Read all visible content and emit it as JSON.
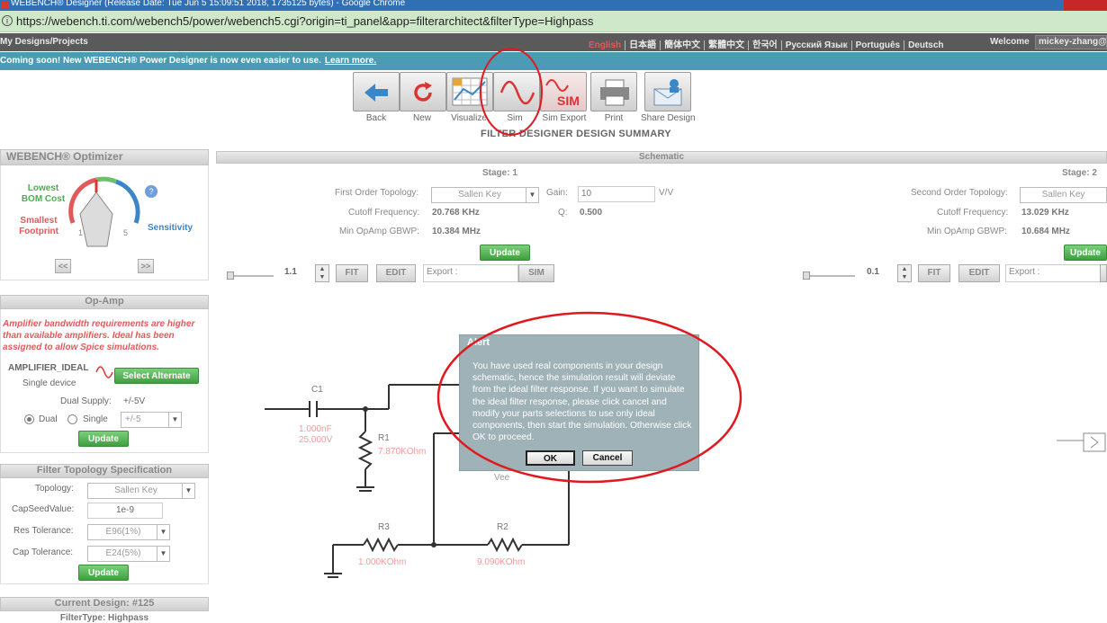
{
  "window": {
    "title": "WEBENCH® Designer (Release Date: Tue Jun 5 15:09:51 2018, 1735125 bytes) - Google Chrome"
  },
  "browser": {
    "url": "https://webench.ti.com/webench5/power/webench5.cgi?origin=ti_panel&app=filterarchitect&filterType=Highpass"
  },
  "header": {
    "left": "My Designs/Projects",
    "languages": [
      "English",
      "日本語",
      "簡体中文",
      "繁體中文",
      "한국어",
      "Русский Язык",
      "Português",
      "Deutsch"
    ],
    "welcome": "Welcome",
    "user": "mickey-zhang@"
  },
  "notice": {
    "text": "Coming soon! New WEBENCH® Power Designer is now even easier to use.",
    "link": "Learn more."
  },
  "toolbar": {
    "items": [
      {
        "label": "Back",
        "icon": "back-arrow-icon"
      },
      {
        "label": "New",
        "icon": "refresh-icon"
      },
      {
        "label": "Visualize",
        "icon": "grid-chart-icon"
      },
      {
        "label": "Sim",
        "icon": "sine-wave-icon"
      },
      {
        "label": "Sim Export",
        "icon": "sim-export-icon"
      },
      {
        "label": "Print",
        "icon": "printer-icon"
      },
      {
        "label": "Share Design",
        "icon": "share-envelope-icon"
      }
    ],
    "summary_title": "FILTER DESIGNER DESIGN SUMMARY",
    "sim_export_badge": "SIM"
  },
  "optimizer": {
    "title": "WEBENCH® Optimizer",
    "lowest_bom_cost": "Lowest\nBOM Cost",
    "smallest_footprint": "Smallest\nFootprint",
    "sensitivity": "Sensitivity",
    "knob_min": "1",
    "knob_max": "5",
    "prev": "<<",
    "next": ">>"
  },
  "opamp": {
    "title": "Op-Amp",
    "warning": "Amplifier bandwidth requirements are higher than available amplifiers. Ideal has been assigned to allow Spice simulations.",
    "part": "AMPLIFIER_IDEAL",
    "device": "Single device",
    "select_alternate": "Select Alternate",
    "dual_supply_label": "Dual Supply:",
    "dual_supply_value": "+/-5V",
    "dual": "Dual",
    "single": "Single",
    "supply_select": "+/-5",
    "update": "Update"
  },
  "topology_spec": {
    "title": "Filter Topology Specification",
    "topology_label": "Topology:",
    "topology_value": "Sallen Key",
    "capseed_label": "CapSeedValue:",
    "capseed_value": "1e-9",
    "res_tol_label": "Res Tolerance:",
    "res_tol_value": "E96(1%)",
    "cap_tol_label": "Cap Tolerance:",
    "cap_tol_value": "E24(5%)",
    "update": "Update"
  },
  "current_design": {
    "title": "Current Design: #125",
    "filter_type": "FilterType: Highpass"
  },
  "schematic": {
    "title": "Schematic",
    "stage1": {
      "stage": "Stage:  1",
      "topology_label": "First Order Topology:",
      "topology_value": "Sallen Key",
      "gain_label": "Gain:",
      "gain_value": "10",
      "gain_unit": "V/V",
      "cutoff_label": "Cutoff Frequency:",
      "cutoff_value": "20.768 KHz",
      "q_label": "Q:",
      "q_value": "0.500",
      "gbwp_label": "Min OpAmp GBWP:",
      "gbwp_value": "10.384 MHz",
      "update": "Update",
      "zoom": "1.1",
      "fit": "FIT",
      "edit": "EDIT",
      "export": "Export :",
      "sim": "SIM"
    },
    "stage2": {
      "stage": "Stage:  2",
      "topology_label": "Second Order Topology:",
      "topology_value": "Sallen Key",
      "cutoff_label": "Cutoff Frequency:",
      "cutoff_value": "13.029 KHz",
      "gbwp_label": "Min OpAmp GBWP:",
      "gbwp_value": "10.684 MHz",
      "update": "Update",
      "zoom": "0.1",
      "fit": "FIT",
      "edit": "EDIT",
      "export": "Export :"
    },
    "components": {
      "c1_name": "C1",
      "c1_value": "1.000nF",
      "c1_voltage": "25.000V",
      "r1_name": "R1",
      "r1_value": "7.870KOhm",
      "r3_name": "R3",
      "r3_value": "1.000KOhm",
      "r2_name": "R2",
      "r2_value": "9.090KOhm",
      "vee": "Vee"
    }
  },
  "dialog": {
    "title": "Alert",
    "message": "You have used real components in your design schematic, hence the simulation result will deviate from the ideal filter response. If you want to simulate the ideal filter response, please click cancel and modify your parts selections to use only ideal components, then start the simulation. Otherwise click OK to proceed.",
    "ok": "OK",
    "cancel": "Cancel"
  },
  "colors": {
    "annotation": "#e0191f",
    "update_green": "#4caf50",
    "teal": "#4a9bb3"
  }
}
